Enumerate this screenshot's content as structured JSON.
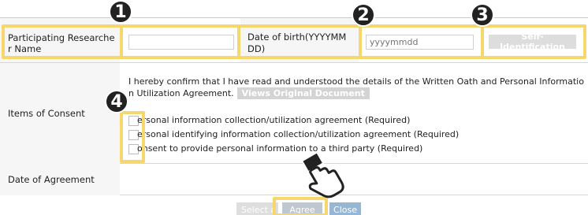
{
  "form": {
    "researcher_label": "Participating Researche r Name",
    "name_value": "",
    "dob_label": "Date of birth(YYYYMM DD)",
    "dob_placeholder": "yyyymmdd",
    "self_id_label": "Self-Identification",
    "consent_label": "Items of Consent",
    "confirm_line1": "I hereby confirm that I have read and understood the details of the Written Oath and Personal Informatio",
    "confirm_line2": "n Utilization Agreement.",
    "view_doc_label": "Views Original Document",
    "consent_items": [
      {
        "label": "ersonal information collection/utilization agreement (Required)"
      },
      {
        "label": "ersonal identifying information collection/utilization agreement (Required)"
      },
      {
        "label": "onsent to provide personal information to a third party (Required)"
      }
    ],
    "date_label": "Date of Agreement"
  },
  "buttons": {
    "select_all": "Select a",
    "agree": "Agree",
    "close": "Close"
  },
  "markers": [
    "1",
    "2",
    "3",
    "4"
  ],
  "colors": {
    "highlight": "#f5d76e",
    "label_bg": "#f6f6f6",
    "close_btn": "#96b6d6",
    "agree_btn": "#bfc8d0"
  },
  "icons": {
    "pointer": "hand-pointer-icon"
  }
}
